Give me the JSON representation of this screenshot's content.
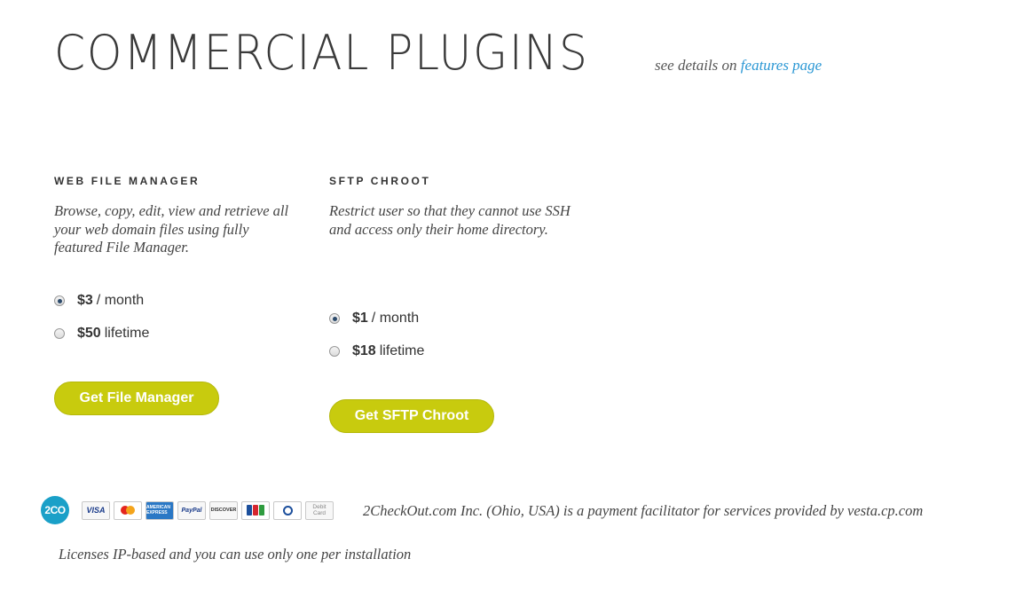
{
  "header": {
    "title": "COMMERCIAL PLUGINS",
    "see_details_prefix": "see details on",
    "features_link": "features page"
  },
  "plugins": [
    {
      "name": "WEB FILE MANAGER",
      "description": "Browse, copy, edit, view and retrieve all your web domain files using fully featured File Manager.",
      "options": [
        {
          "price": "$3",
          "period": "/ month",
          "selected": true
        },
        {
          "price": "$50",
          "period": "lifetime",
          "selected": false
        }
      ],
      "button": "Get File Manager"
    },
    {
      "name": "SFTP CHROOT",
      "description": "Restrict user so that they cannot use SSH and access only their home directory.",
      "options": [
        {
          "price": "$1",
          "period": "/ month",
          "selected": true
        },
        {
          "price": "$18",
          "period": "lifetime",
          "selected": false
        }
      ],
      "button": "Get SFTP Chroot"
    }
  ],
  "payment": {
    "logo": "2CO",
    "cards": [
      "VISA",
      "MasterCard",
      "AMERICAN EXPRESS",
      "PayPal",
      "DISCOVER",
      "JCB",
      "Diners Club",
      "Debit Card"
    ],
    "note": "2CheckOut.com Inc. (Ohio, USA) is a payment facilitator for services provided by vesta.cp.com"
  },
  "license_note": "Licenses IP-based and you can use only one per installation",
  "colors": {
    "button": "#c8cb0e",
    "link": "#2a97d4",
    "logo_2co": "#1aa0c8"
  }
}
